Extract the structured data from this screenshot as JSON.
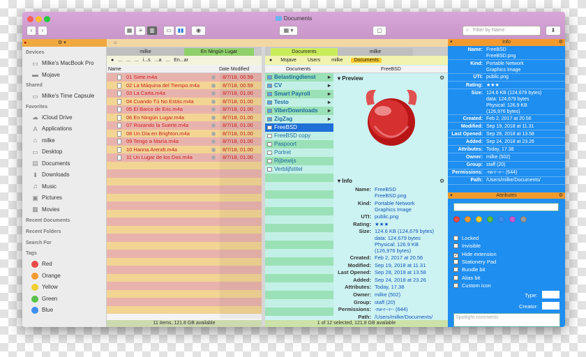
{
  "window": {
    "title": "Documents",
    "filter_placeholder": "Filter by Name"
  },
  "toolbar": {
    "nav": [
      "Documents",
      "Music",
      "Movies",
      "Pictures",
      "Desktop",
      "Applications"
    ]
  },
  "sidebar": {
    "devices_header": "Devices",
    "devices": [
      "Milke's MacBook Pro",
      "Mojave"
    ],
    "shared_header": "Shared",
    "shared": [
      "Milke's Time Capsule"
    ],
    "favorites_header": "Favorites",
    "favorites": [
      "iCloud Drive",
      "Applications",
      "milke",
      "Desktop",
      "Documents",
      "Downloads",
      "Music",
      "Pictures",
      "Movies"
    ],
    "recent_documents": "Recent Documents",
    "recent_folders": "Recent Folders",
    "search_for": "Search For",
    "tags_header": "Tags",
    "tags": [
      {
        "name": "Red",
        "color": "#ec4a48"
      },
      {
        "name": "Orange",
        "color": "#f59c30"
      },
      {
        "name": "Yellow",
        "color": "#f2cf2f"
      },
      {
        "name": "Green",
        "color": "#5ac14a"
      },
      {
        "name": "Blue",
        "color": "#3d90f3"
      }
    ]
  },
  "pane1": {
    "tabs": [
      "milke",
      "En Ningún Lugar"
    ],
    "path": [
      "...",
      "...",
      "...",
      "i...s",
      "...a",
      "...",
      "En...ar"
    ],
    "col_name": "Name",
    "col_date": "Date Modified",
    "rows": [
      {
        "name": "01 Siete.m4a",
        "date": "8/7/18, 00.59"
      },
      {
        "name": "02 La Máquina del Tiempo.m4a",
        "date": "8/7/18, 00.59"
      },
      {
        "name": "03 La Carta.m4a",
        "date": "8/7/18, 01.00"
      },
      {
        "name": "04 Cuando Tú No Estás.m4a",
        "date": "8/7/18, 01.00"
      },
      {
        "name": "05 El Barco de Eric.m4a",
        "date": "8/7/18, 01.00"
      },
      {
        "name": "06 En Ningún Lugar.m4a",
        "date": "8/7/18, 01.00"
      },
      {
        "name": "07 Rozando la Suerte.m4a",
        "date": "8/7/18, 01.00"
      },
      {
        "name": "08 Un Día en Brighton.m4a",
        "date": "8/7/18, 01.00"
      },
      {
        "name": "09 Tengo a María.m4a",
        "date": "8/7/18, 01.00"
      },
      {
        "name": "10 Hanna Arendt.m4a",
        "date": "8/7/18, 01.00"
      },
      {
        "name": "11 Un Lugar de los Dos.m4a",
        "date": "8/7/18, 01.00"
      }
    ],
    "status": "11 items, 121.8 GB available"
  },
  "pane2": {
    "tabs": [
      "Documents",
      "milke"
    ],
    "path": [
      "Mojave",
      "Users",
      "milke",
      "Documents"
    ],
    "col_documents": "Documents",
    "col_freebsd": "FreeBSD",
    "folders": [
      "Belastingdienst",
      "CV",
      "Smart Payroll",
      "Testo",
      "ViberDownloads",
      "ZigZag"
    ],
    "files": [
      "FreeBSD",
      "FreeBSD copy",
      "Paspoort",
      "Portret",
      "Rijbewijs",
      "Verblijfstitel"
    ],
    "preview_header": "Preview",
    "info_header": "Info",
    "info": [
      {
        "k": "Name:",
        "v": "FreeBSD\nFreeBSD.png"
      },
      {
        "k": "Kind:",
        "v": "Portable Network\nGraphics Image"
      },
      {
        "k": "UTI:",
        "v": "public.png"
      },
      {
        "k": "Rating:",
        "v": "★★★"
      },
      {
        "k": "Size:",
        "v": "124.6 KB (124,679 bytes)\ndata: 124,679 bytes\nPhysical: 126.9 KB\n(126,976 bytes)"
      },
      {
        "k": "Created:",
        "v": "Feb 2, 2017 at 20.56"
      },
      {
        "k": "Modified:",
        "v": "Sep 19, 2018 at 11.31"
      },
      {
        "k": "Last Opened:",
        "v": "Sep 28, 2018 at 13.58"
      },
      {
        "k": "Added:",
        "v": "Sep 24, 2018 at 23.26"
      },
      {
        "k": "Attributes:",
        "v": "Today, 17.38"
      },
      {
        "k": "Owner:",
        "v": "milke (502)"
      },
      {
        "k": "Group:",
        "v": "staff (20)"
      },
      {
        "k": "Permissions:",
        "v": "-rw-r--r-- (644)"
      },
      {
        "k": "Path:",
        "v": "/Users/milke/Documents/"
      }
    ],
    "status": "1 of 12 selected, 121.8 GB available"
  },
  "pane3": {
    "info_title": "Info",
    "attributes_title": "Attributes",
    "info": [
      {
        "k": "Name:",
        "v": "FreeBSD\nFreeBSD.png"
      },
      {
        "k": "Kind:",
        "v": "Portable Network\nGraphics Image"
      },
      {
        "k": "UTI:",
        "v": "public.png"
      },
      {
        "k": "Rating:",
        "v": "★★★"
      },
      {
        "k": "Size:",
        "v": "124.6 KB (124,679 bytes)\ndata: 124,679 bytes\nPhysical: 126.9 KB\n(126,976 bytes)"
      },
      {
        "k": "Created:",
        "v": "Feb 2, 2017 at 20.56"
      },
      {
        "k": "Modified:",
        "v": "Sep 19, 2018 at 11.31"
      },
      {
        "k": "Last Opened:",
        "v": "Sep 28, 2018 at 13.58"
      },
      {
        "k": "Added:",
        "v": "Sep 24, 2018 at 23.26"
      },
      {
        "k": "Attributes:",
        "v": "Today, 17.38"
      },
      {
        "k": "Owner:",
        "v": "milke (502)"
      },
      {
        "k": "Group:",
        "v": "staff (20)"
      },
      {
        "k": "Permissions:",
        "v": "-rw-r--r-- (644)"
      },
      {
        "k": "Path:",
        "v": "/Users/milke/Documents/"
      }
    ],
    "tag_colors": [
      "#ec4a48",
      "#f59c30",
      "#f2cf2f",
      "#5ac14a",
      "#3d90f3",
      "#c65cd6",
      "#999999"
    ],
    "checks": [
      {
        "label": "Locked",
        "on": false
      },
      {
        "label": "Invisible",
        "on": false
      },
      {
        "label": "Hide extension",
        "on": true
      },
      {
        "label": "Stationery Pad",
        "on": false
      },
      {
        "label": "Bundle bit",
        "on": false
      },
      {
        "label": "Alias bit",
        "on": false
      },
      {
        "label": "Custom icon",
        "on": false
      }
    ],
    "type_label": "Type:",
    "creator_label": "Creator:",
    "spotlight_placeholder": "Spotlight comments"
  }
}
